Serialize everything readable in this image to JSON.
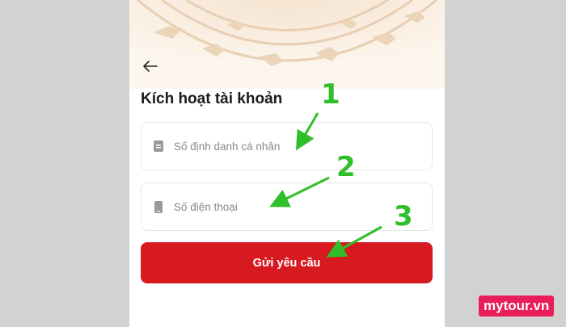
{
  "screen": {
    "title": "Kích hoạt tài khoản",
    "back_icon": "arrow-left-icon"
  },
  "fields": {
    "id_number": {
      "placeholder": "Số định danh cá nhân",
      "icon": "id-card-icon"
    },
    "phone": {
      "placeholder": "Số điện thoại",
      "icon": "phone-icon"
    }
  },
  "submit": {
    "label": "Gửi yêu cầu",
    "color": "#d71920"
  },
  "annotations": {
    "step1": "1",
    "step2": "2",
    "step3": "3",
    "color": "#2fbf2a"
  },
  "watermark": {
    "text": "mytour.vn",
    "color": "#e81d5a"
  }
}
